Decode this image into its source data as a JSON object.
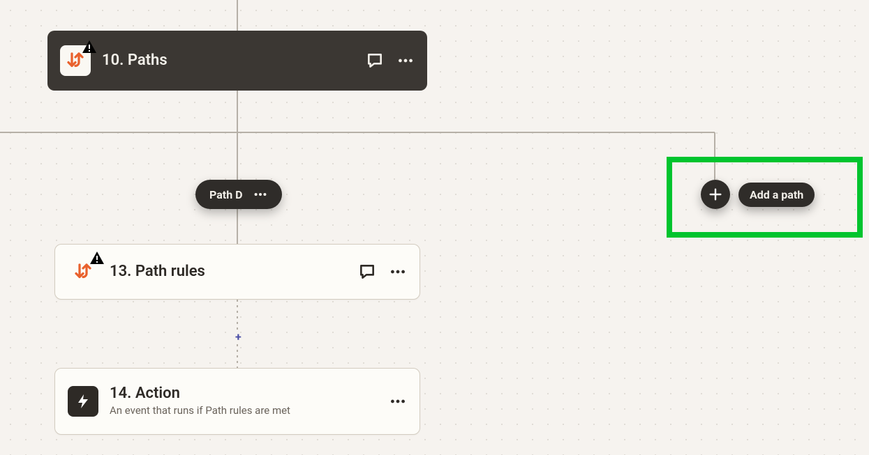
{
  "paths_node": {
    "title": "10. Paths",
    "has_warning": true
  },
  "branch_pill": {
    "label": "Path D"
  },
  "rules_node": {
    "title": "13. Path rules",
    "has_warning": true
  },
  "action_node": {
    "title": "14. Action",
    "subtitle": "An event that runs if Path rules are met"
  },
  "add_path": {
    "label": "Add a path"
  }
}
